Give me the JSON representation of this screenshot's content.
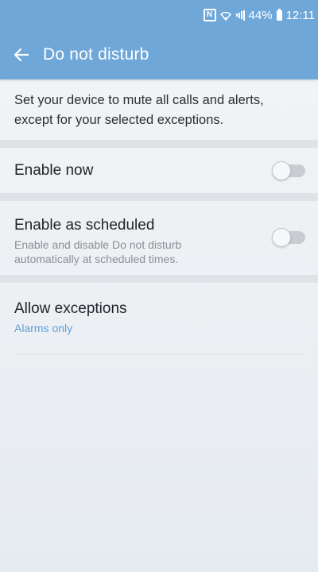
{
  "status_bar": {
    "nfc_icon": "nfc-icon",
    "wifi_icon": "wifi-icon",
    "signal_icon": "signal-icon",
    "battery_percent": "44%",
    "battery_icon": "battery-icon",
    "time": "12:11"
  },
  "app_bar": {
    "title": "Do not disturb",
    "back_icon": "back-arrow-icon",
    "color": "#6fa7d9"
  },
  "description": "Set your device to mute all calls and alerts, except for your selected exceptions.",
  "settings": {
    "enable_now": {
      "label": "Enable now",
      "on": false
    },
    "enable_scheduled": {
      "label": "Enable as scheduled",
      "summary": "Enable and disable Do not disturb automatically at scheduled times.",
      "on": false
    },
    "allow_exceptions": {
      "label": "Allow exceptions",
      "value": "Alarms only",
      "value_color": "#5f9fd6"
    }
  }
}
